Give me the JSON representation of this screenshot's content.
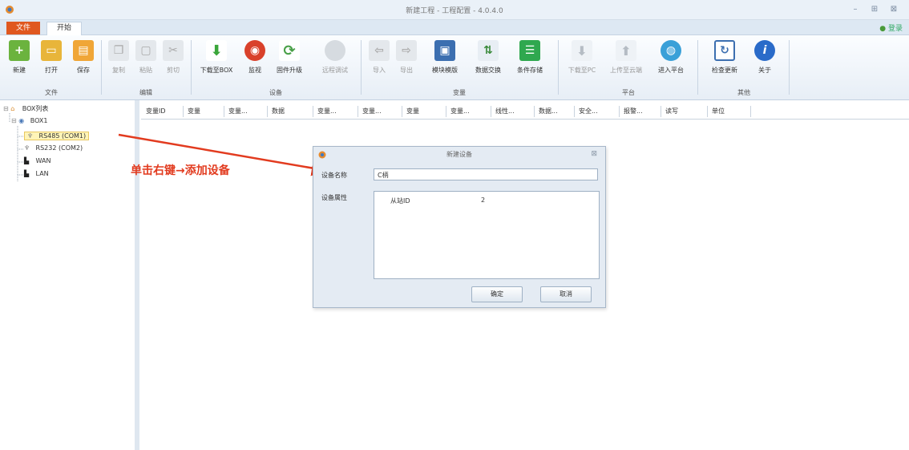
{
  "window": {
    "title": "新建工程 - 工程配置 - 4.0.4.0"
  },
  "tabs": {
    "file": "文件",
    "start": "开始",
    "login": "登录"
  },
  "ribbon": {
    "groups": [
      "文件",
      "编辑",
      "设备",
      "变量",
      "平台",
      "其他"
    ],
    "buttons": {
      "new": "新建",
      "open": "打开",
      "save": "保存",
      "copy": "复制",
      "paste": "粘贴",
      "cut": "剪切",
      "download_box": "下载至BOX",
      "monitor": "监视",
      "firmware": "固件升级",
      "remote": "远程调试",
      "import": "导入",
      "export": "导出",
      "template": "模块模版",
      "data_exchange": "数据交换",
      "condition_store": "条件存储",
      "download_pc": "下载至PC",
      "upload_cloud": "上传至云端",
      "enter_platform": "进入平台",
      "check_update": "检查更新",
      "about": "关于"
    }
  },
  "tree": {
    "root": "BOX列表",
    "box": "BOX1",
    "ports": [
      "RS485 (COM1)",
      "RS232 (COM2)",
      "WAN",
      "LAN"
    ]
  },
  "grid": {
    "columns": [
      "变量ID",
      "变量",
      "变量...",
      "数据",
      "变量...",
      "变量...",
      "变量",
      "变量...",
      "线性...",
      "数据...",
      "安全...",
      "报警...",
      "读写",
      "单位"
    ]
  },
  "annotation": "单击右键→添加设备",
  "dialog": {
    "title": "新建设备",
    "name_label": "设备名称",
    "name_value": "C柄",
    "prop_label": "设备属性",
    "prop_key": "从站ID",
    "prop_value": "2",
    "ok": "确定",
    "cancel": "取消"
  },
  "colors": {
    "accent": "#e0581f",
    "annotation": "#e23b1f"
  }
}
